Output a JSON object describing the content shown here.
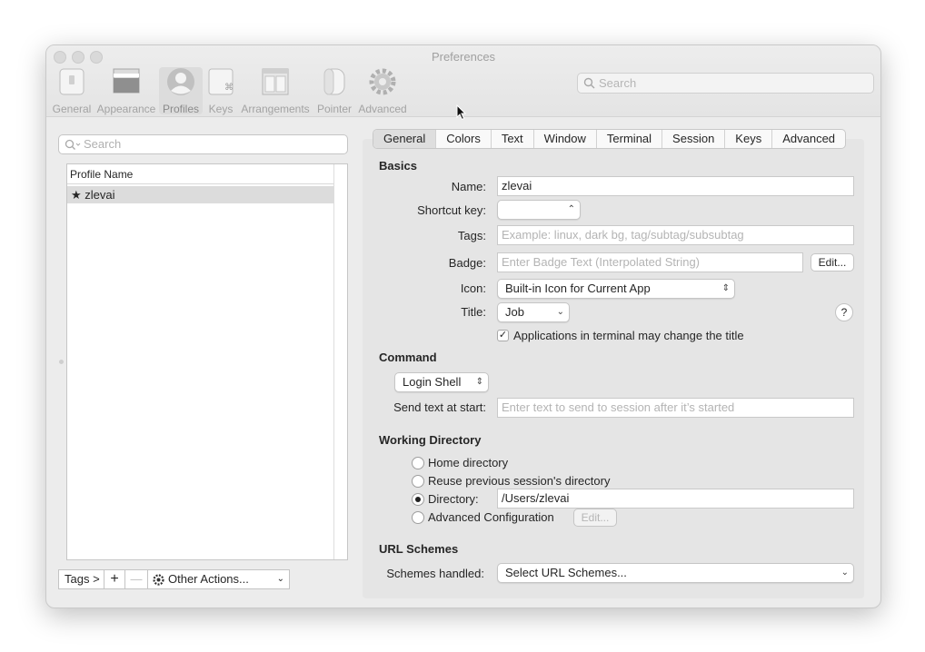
{
  "window": {
    "title": "Preferences"
  },
  "toolbar": {
    "items": [
      {
        "label": "General",
        "icon": "switch-icon"
      },
      {
        "label": "Appearance",
        "icon": "window-layout-icon"
      },
      {
        "label": "Profiles",
        "icon": "user-profile-icon"
      },
      {
        "label": "Keys",
        "icon": "command-key-icon"
      },
      {
        "label": "Arrangements",
        "icon": "window-arrangement-icon"
      },
      {
        "label": "Pointer",
        "icon": "mouse-icon"
      },
      {
        "label": "Advanced",
        "icon": "gear-icon"
      }
    ],
    "selected": "Profiles",
    "search_placeholder": "Search"
  },
  "profiles": {
    "search_placeholder": "Search",
    "column_header": "Profile Name",
    "items": [
      {
        "name": "zlevai",
        "default_marker": "★"
      }
    ],
    "tags_label": "Tags >",
    "add_label": "+",
    "remove_label": "—",
    "other_actions_label": "Other Actions..."
  },
  "tabs": [
    "General",
    "Colors",
    "Text",
    "Window",
    "Terminal",
    "Session",
    "Keys",
    "Advanced"
  ],
  "selected_tab": "General",
  "basics": {
    "heading": "Basics",
    "name_label": "Name:",
    "name_value": "zlevai",
    "shortcut_label": "Shortcut key:",
    "tags_label": "Tags:",
    "tags_placeholder": "Example: linux, dark bg, tag/subtag/subsubtag",
    "badge_label": "Badge:",
    "badge_placeholder": "Enter Badge Text (Interpolated String)",
    "badge_edit": "Edit...",
    "icon_label": "Icon:",
    "icon_value": "Built-in Icon for Current App",
    "title_label": "Title:",
    "title_value": "Job",
    "help": "?",
    "apps_change_title": "Applications in terminal may change the title"
  },
  "command": {
    "heading": "Command",
    "shell_value": "Login Shell",
    "send_text_label": "Send text at start:",
    "send_text_placeholder": "Enter text to send to session after it’s started"
  },
  "working_dir": {
    "heading": "Working Directory",
    "home": "Home directory",
    "reuse": "Reuse previous session's directory",
    "directory": "Directory:",
    "directory_value": "/Users/zlevai",
    "advanced": "Advanced Configuration",
    "advanced_edit": "Edit..."
  },
  "url": {
    "heading": "URL Schemes",
    "label": "Schemes handled:",
    "value": "Select URL Schemes..."
  }
}
